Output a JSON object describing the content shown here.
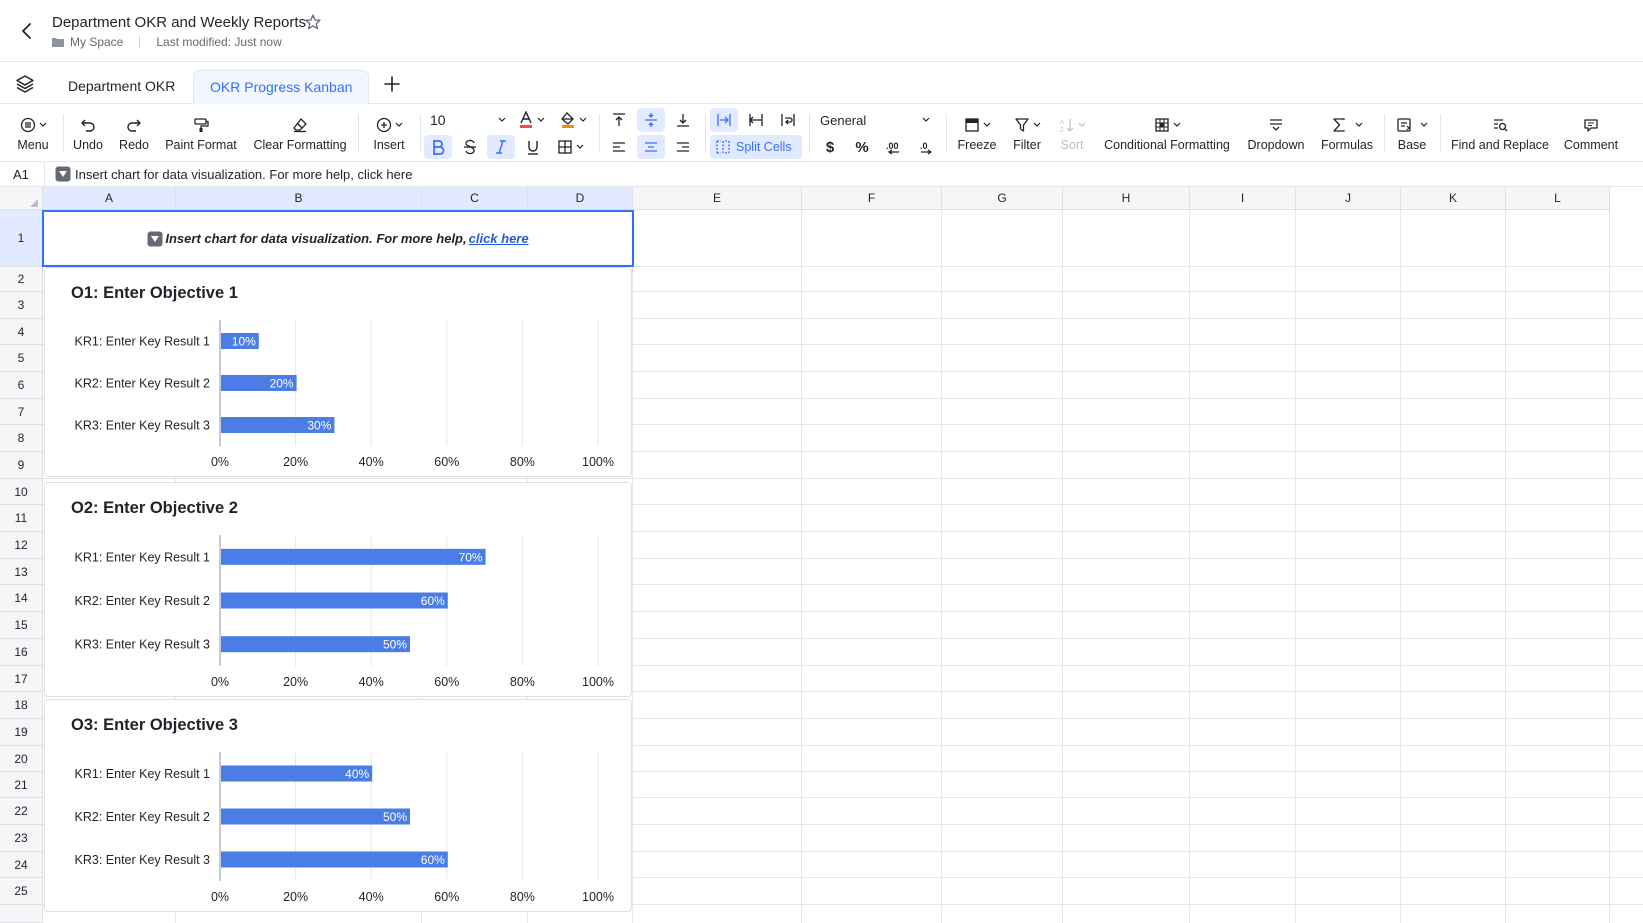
{
  "titlebar": {
    "title": "Department OKR and Weekly Reports",
    "location": "My Space",
    "modified": "Last modified: Just now"
  },
  "tabs": [
    "Department OKR",
    "OKR Progress Kanban"
  ],
  "toolbar": {
    "menu": "Menu",
    "undo": "Undo",
    "redo": "Redo",
    "paint_format": "Paint Format",
    "clear_formatting": "Clear Formatting",
    "insert": "Insert",
    "font_size": "10",
    "split_cells": "Split Cells",
    "number_format": "General",
    "freeze": "Freeze",
    "filter": "Filter",
    "sort": "Sort",
    "conditional_formatting": "Conditional Formatting",
    "dropdown": "Dropdown",
    "formulas": "Formulas",
    "base": "Base",
    "find_replace": "Find and Replace",
    "comment": "Comment",
    "currency": "$",
    "percent": "%"
  },
  "formula_bar": {
    "cell_ref": "A1",
    "content": "Insert chart for data visualization. For more help, click here"
  },
  "columns": [
    "A",
    "B",
    "C",
    "D",
    "E",
    "F",
    "G",
    "H",
    "I",
    "J",
    "K",
    "L"
  ],
  "rows": [
    "1",
    "2",
    "3",
    "4",
    "5",
    "6",
    "7",
    "8",
    "9",
    "10",
    "11",
    "12",
    "13",
    "14",
    "15",
    "16",
    "17",
    "18",
    "19",
    "20",
    "21",
    "22",
    "23",
    "24",
    "25"
  ],
  "cell_a1": {
    "text": "Insert chart for data visualization. For more help, ",
    "link": "click here"
  },
  "colors": {
    "accent": "#3370ff",
    "bar": "#4a7ee6"
  },
  "chart_data": [
    {
      "type": "bar",
      "orientation": "horizontal",
      "title": "O1: Enter Objective 1",
      "categories": [
        "KR1: Enter Key Result 1",
        "KR2: Enter Key Result 2",
        "KR3: Enter Key Result 3"
      ],
      "values": [
        10,
        20,
        30
      ],
      "data_labels": [
        "10%",
        "20%",
        "30%"
      ],
      "xlim": [
        0,
        100
      ],
      "x_ticks": [
        "0%",
        "20%",
        "40%",
        "60%",
        "80%",
        "100%"
      ],
      "grid": true
    },
    {
      "type": "bar",
      "orientation": "horizontal",
      "title": "O2: Enter Objective 2",
      "categories": [
        "KR1: Enter Key Result 1",
        "KR2: Enter Key Result 2",
        "KR3: Enter Key Result 3"
      ],
      "values": [
        70,
        60,
        50
      ],
      "data_labels": [
        "70%",
        "60%",
        "50%"
      ],
      "xlim": [
        0,
        100
      ],
      "x_ticks": [
        "0%",
        "20%",
        "40%",
        "60%",
        "80%",
        "100%"
      ],
      "grid": true
    },
    {
      "type": "bar",
      "orientation": "horizontal",
      "title": "O3: Enter Objective 3",
      "categories": [
        "KR1: Enter Key Result 1",
        "KR2: Enter Key Result 2",
        "KR3: Enter Key Result 3"
      ],
      "values": [
        40,
        50,
        60
      ],
      "data_labels": [
        "40%",
        "50%",
        "60%"
      ],
      "xlim": [
        0,
        100
      ],
      "x_ticks": [
        "0%",
        "20%",
        "40%",
        "60%",
        "80%",
        "100%"
      ],
      "grid": true
    }
  ]
}
